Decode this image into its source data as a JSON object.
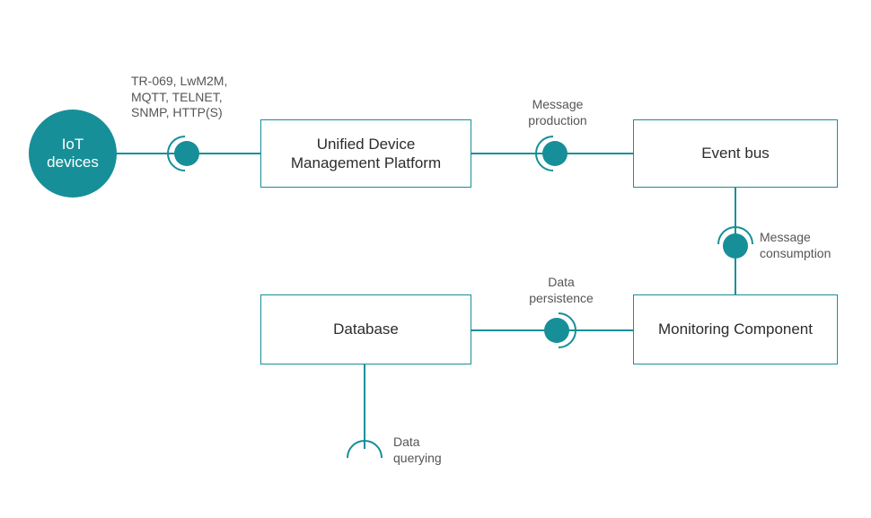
{
  "colors": {
    "accent": "#178f98",
    "text": "#333333",
    "muted": "#555555"
  },
  "nodes": {
    "iot": {
      "label": "IoT\ndevices"
    },
    "udmp": {
      "label": "Unified Device\nManagement Platform"
    },
    "eventbus": {
      "label": "Event bus"
    },
    "monitor": {
      "label": "Monitoring Component"
    },
    "database": {
      "label": "Database"
    }
  },
  "connectors": {
    "protocols": {
      "label": "TR-069, LwM2M,\nMQTT, TELNET,\nSNMP, HTTP(S)"
    },
    "production": {
      "label": "Message\nproduction"
    },
    "consumption": {
      "label": "Message\nconsumption"
    },
    "persistence": {
      "label": "Data\npersistence"
    },
    "querying": {
      "label": "Data\nquerying"
    }
  }
}
